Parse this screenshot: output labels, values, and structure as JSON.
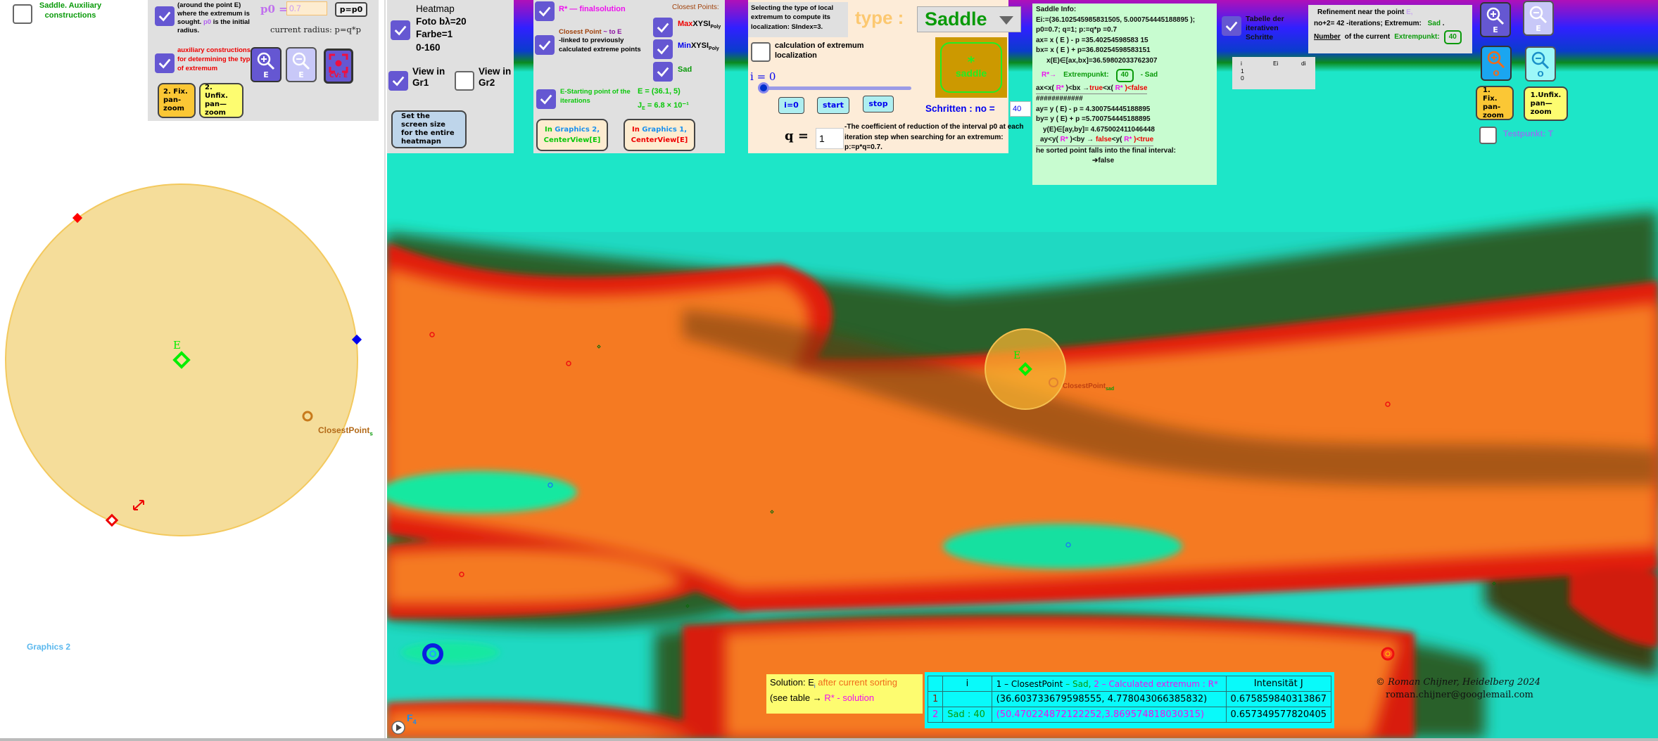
{
  "left_panel": {
    "saddle_aux_label": "Saddle. Auxiliary constructions",
    "saddle_aux_checked": false,
    "graphics2_label": "Graphics 2",
    "closest_point_label": "ClosestPoint",
    "closest_point_sub": "s",
    "E_label": "E"
  },
  "radius_panel": {
    "around_text": "(around the point E) where the extremum is sought.",
    "p0_word": "p0",
    "initial_radius_text": "is the initial radius.",
    "around_checked": true,
    "p0_label": "p0 =",
    "p0_value": "0.7",
    "p_eq_p0_button": "p=p0",
    "current_radius": "current radius: p=q*p",
    "aux_text": "auxiliary constructions for determining the type of extremum",
    "aux_checked": true,
    "zoom_in_E": "E",
    "zoom_out_E": "E",
    "center_view_E": "CV: E",
    "fix_pan_zoom_2": "2. Fix. pan-zoom",
    "unfix_pan_zoom_2": "2. Unfix. pan—zoom"
  },
  "heatmap_panel": {
    "title": "Heatmap",
    "foto": "Foto bλ=20",
    "farbe": "Farbe=1",
    "range": "0-160",
    "heatmap_checked": true,
    "view_gr1": "View in Gr1",
    "view_gr1_checked": true,
    "view_gr2": "View in Gr2",
    "view_gr2_checked": false,
    "screen_size_button": "Set the screen size for the entire heatmapn"
  },
  "solution_panel": {
    "rstar_label": "R* — finalsolution",
    "rstar_checked": true,
    "closest_title": "Closest Point",
    "closest_tilde": "~ to E",
    "closest_desc": "-linked to previously calculated extreme points",
    "closest_checked": true,
    "closest_points_title": "Closest Points:",
    "max_prefix": "Max",
    "min_prefix": "Min",
    "xysi": "XYSI",
    "poly_sub": "Poly",
    "max_checked": true,
    "min_checked": true,
    "sad_label": "Sad",
    "sad_checked": true,
    "start_label": "E-Starting point of the iterations",
    "start_checked": true,
    "E_value": "E = (36.1, 5)",
    "JE_value": "J",
    "JE_sub": "E",
    "JE_rest": "= 6.8 × 10⁻¹",
    "gr2_center_prefix": "In ",
    "gr2_center_graphics": "Graphics 2,",
    "gr2_center_cmd": "CenterView[E]",
    "gr1_center_prefix": "In ",
    "gr1_center_graphics": "Graphics 1,",
    "gr1_center_cmd": "CenterView[E]"
  },
  "type_panel": {
    "select_info": "Selecting the type of local extremum to compute its localization: SIndex=3.",
    "type_label": "type :",
    "type_value": "Saddle",
    "calc_label": "calculation of extremum localization",
    "calc_checked": false,
    "i_label": "i = 0",
    "slider_value": 0,
    "i0_button": "i=0",
    "start_button": "start",
    "stop_button": "stop",
    "saddle_badge_star": "*",
    "saddle_badge_text": "saddle",
    "schritten_label": "Schritten : no =",
    "schritten_value": "40",
    "q_label": "q =",
    "q_value": "1",
    "coef_text": "-The coefficient of reduction of the interval p0 at each iteration step when searching for an extremum: p:=p*q=0.7."
  },
  "saddle_info": {
    "title": "Saddle Info:",
    "Ei": "Ei:=(36.102545985831505, 5.000754445188895 );",
    "p_line": "p0=0.7; q=1;   p:=q*p =0.7",
    "ax": "ax= x ( E ) - p =35.40254598583 15",
    "bx": "bx= x ( E ) + p=36.80254598583151",
    "xE": "x(E)∈[ax,bx]=36.59802033762307",
    "rstar": "R*→",
    "extrempunkt": "Extrempunkt:",
    "extrempunkt_no": "40",
    "sad_suffix": "- Sad",
    "x_cmp_a": "ax<x(",
    "x_cmp_b": ")<bx →",
    "x_true": "true",
    "x_cmp_c": "<x(",
    "x_false": ")<false",
    "hashes": "############",
    "ay": "ay= y ( E) - p = 4.300754445188895",
    "by": "by= y ( E) + p =5.700754445188895",
    "yE": "y(E)∈[ay,by]= 4.675002411046448",
    "y_cmp_a": "ay<y(",
    "y_cmp_b": ")<by →",
    "y_false": "false",
    "y_cmp_c": "<y(",
    "y_true": ")<true",
    "sorted_text": "he sorted point falls into the final interval:",
    "result": "➔false",
    "rs": "R*"
  },
  "iter_panel": {
    "tabelle_label": "Tabelle der iterativen Schritte",
    "tabelle_checked": true,
    "refine_title": "Refinement near the point",
    "refine_E": "E,",
    "iterations": "no+2=  42 -iterations;  Extremum:",
    "extremum_type": "Sad",
    "number_word": "Number",
    "current_text": "of the current",
    "extrempunkt": "Extrempunkt:",
    "extrempunkt_no": "40",
    "table_headers": [
      "i",
      "Ei",
      "di"
    ],
    "table_rows": [
      "1",
      "0"
    ]
  },
  "right_tools": {
    "zoom_in_E": "E",
    "zoom_out_E": "E",
    "zoom_in_O": "O",
    "zoom_out_O": "O",
    "fix_pan_zoom_1": "1. Fix. pan-zoom",
    "unfix_pan_zoom_1": "1.Unfix. pan—zoom",
    "testpunkt": "Testpunkt: T",
    "testpunkt_checked": false
  },
  "heatmap_labels": {
    "E_label": "E",
    "closest_point": "ClosestPoint",
    "closest_sub": "sad",
    "f4": "F",
    "f4_sub": "4"
  },
  "solution_note": {
    "line1_prefix": "Solution: E",
    "line1_sub": "i",
    "line1_suffix": " after current sorting",
    "line2_prefix": " (see table → ",
    "line2_rstar": "R* - solution"
  },
  "results_table": {
    "headers": [
      "",
      "i",
      "1 – ClosestPoint",
      "– Sad,",
      "2 – Calculated extremum :  R*",
      "Intensität J"
    ],
    "rows": [
      {
        "n": "1",
        "i": "",
        "point": "(36.603733679598555, 4.778043066385832)",
        "J": "0.675859840313867"
      },
      {
        "n": "2",
        "i": "Sad : 40",
        "point": "(50.470224872122252,3.869574818030315)",
        "J": "0.657349577820405"
      }
    ]
  },
  "credits": {
    "line1": "©  Roman Chijner, Heidelberg 2024",
    "line2": "roman.chijner@googlemail.com"
  },
  "colors": {
    "accent_checkbox": "#6557d2",
    "green": "#0a9a0a",
    "magenta": "#ee11ee",
    "red": "#ee0000",
    "blue": "#0000ee"
  }
}
